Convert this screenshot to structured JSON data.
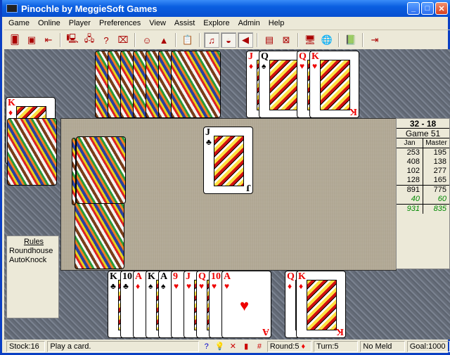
{
  "window": {
    "title": "Pinochle by MeggieSoft Games",
    "buttons": [
      "minimize",
      "maximize",
      "close"
    ]
  },
  "menu": [
    "Game",
    "Online",
    "Player",
    "Preferences",
    "View",
    "Assist",
    "Explore",
    "Admin",
    "Help"
  ],
  "toolbar": [
    {
      "icon": "new-game-icon",
      "glyph": "🂠"
    },
    {
      "icon": "deal-icon",
      "glyph": "▣"
    },
    {
      "icon": "undo-card-icon",
      "glyph": "⇤"
    },
    {
      "sep": true
    },
    {
      "icon": "network-clock-icon",
      "glyph": "🖳"
    },
    {
      "icon": "network-connect-icon",
      "glyph": "🖧"
    },
    {
      "icon": "network-help-icon",
      "glyph": "?"
    },
    {
      "icon": "network-disabled-icon",
      "glyph": "⌧"
    },
    {
      "sep": true
    },
    {
      "icon": "player-swap-icon",
      "glyph": "☺"
    },
    {
      "icon": "wizard-icon",
      "glyph": "▲"
    },
    {
      "sep": true
    },
    {
      "icon": "clipboard-icon",
      "glyph": "📋"
    },
    {
      "sep": true
    },
    {
      "icon": "music-toggle-icon",
      "glyph": "♫",
      "pressed": true
    },
    {
      "icon": "voice-toggle-icon",
      "glyph": "◒",
      "pressed": true
    },
    {
      "icon": "sound-toggle-icon",
      "glyph": "◀",
      "pressed": true
    },
    {
      "sep": true
    },
    {
      "icon": "modem-icon",
      "glyph": "▤"
    },
    {
      "icon": "modem-disabled-icon",
      "glyph": "⊠"
    },
    {
      "sep": true
    },
    {
      "icon": "computer-web-icon",
      "glyph": "🖥"
    },
    {
      "icon": "globe-icon",
      "glyph": "🌐"
    },
    {
      "sep": true
    },
    {
      "icon": "help-book-icon",
      "glyph": "📗"
    },
    {
      "sep": true
    },
    {
      "icon": "exit-icon",
      "glyph": "⇥"
    }
  ],
  "north_hand": {
    "card_count": 7,
    "face": "back"
  },
  "north_meld": [
    {
      "rank": "J",
      "suit": "♦",
      "color": "red"
    },
    {
      "rank": "Q",
      "suit": "♠",
      "color": "black"
    },
    {
      "rank": "Q",
      "suit": "♥",
      "color": "red"
    },
    {
      "rank": "K",
      "suit": "♥",
      "color": "red"
    }
  ],
  "west_meld": [
    {
      "rank": "K",
      "suit": "♦",
      "color": "red"
    }
  ],
  "stock": {
    "face": "back"
  },
  "trick": [
    {
      "rank": "J",
      "suit": "♣",
      "color": "black"
    }
  ],
  "rules": {
    "title": "Rules",
    "items": [
      "Roundhouse",
      "AutoKnock"
    ]
  },
  "player_hand": [
    {
      "rank": "K",
      "suit": "♣",
      "color": "black"
    },
    {
      "rank": "10",
      "suit": "♣",
      "color": "black"
    },
    {
      "rank": "A",
      "suit": "♦",
      "color": "red"
    },
    {
      "rank": "K",
      "suit": "♠",
      "color": "black"
    },
    {
      "rank": "A",
      "suit": "♠",
      "color": "black"
    },
    {
      "rank": "9",
      "suit": "♥",
      "color": "red"
    },
    {
      "rank": "J",
      "suit": "♥",
      "color": "red"
    },
    {
      "rank": "Q",
      "suit": "♥",
      "color": "red"
    },
    {
      "rank": "10",
      "suit": "♥",
      "color": "red"
    },
    {
      "rank": "A",
      "suit": "♥",
      "color": "red"
    }
  ],
  "player_meld": [
    {
      "rank": "Q",
      "suit": "♦",
      "color": "red"
    },
    {
      "rank": "K",
      "suit": "♦",
      "color": "red"
    }
  ],
  "score": {
    "header": "32 - 18",
    "game": "Game  51",
    "players": [
      "Jan",
      "Master"
    ],
    "rounds": [
      [
        253,
        195
      ],
      [
        408,
        138
      ],
      [
        102,
        277
      ],
      [
        128,
        165
      ]
    ],
    "total": [
      891,
      775
    ],
    "bonus": [
      40,
      60
    ],
    "grand": [
      931,
      835
    ]
  },
  "status": {
    "stock": "Stock:16",
    "message": "Play a card.",
    "icons": [
      {
        "name": "help-icon",
        "glyph": "?",
        "color": "#00c"
      },
      {
        "name": "hint-bulb-icon",
        "glyph": "💡",
        "color": "#cc0"
      },
      {
        "name": "network-off-icon",
        "glyph": "✕",
        "color": "#c00"
      },
      {
        "name": "bars-chart-icon",
        "glyph": "▮",
        "color": "#c00"
      },
      {
        "name": "score-table-icon",
        "glyph": "#",
        "color": "#c00"
      }
    ],
    "round": "Round:5",
    "round_suit": "♦",
    "turn": "Turn:5",
    "meld": "No Meld",
    "goal": "Goal:1000"
  }
}
